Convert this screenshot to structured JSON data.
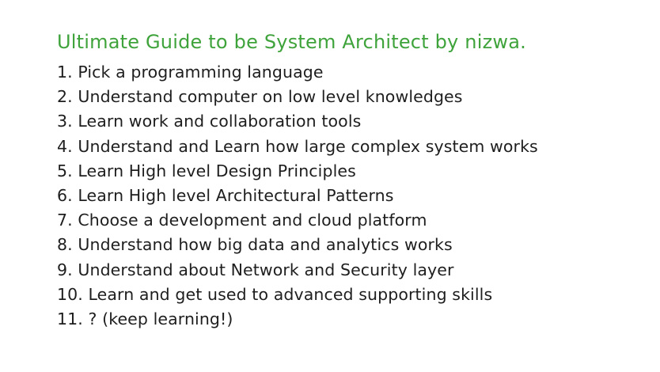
{
  "title": "Ultimate Guide to be System Architect by nizwa.",
  "steps": [
    "1. Pick a programming language",
    "2. Understand computer on low level knowledges",
    "3. Learn work and collaboration tools",
    "4. Understand and Learn how large complex system works",
    "5. Learn High level Design Principles",
    "6. Learn High level Architectural Patterns",
    "7. Choose a development and cloud platform",
    "8. Understand how big data and analytics works",
    "9. Understand about Network and Security layer",
    "10. Learn and get used to advanced supporting skills",
    "11. ? (keep learning!)"
  ],
  "colors": {
    "title": "#3fa33b",
    "text": "#1e1e1e",
    "background": "#ffffff"
  }
}
